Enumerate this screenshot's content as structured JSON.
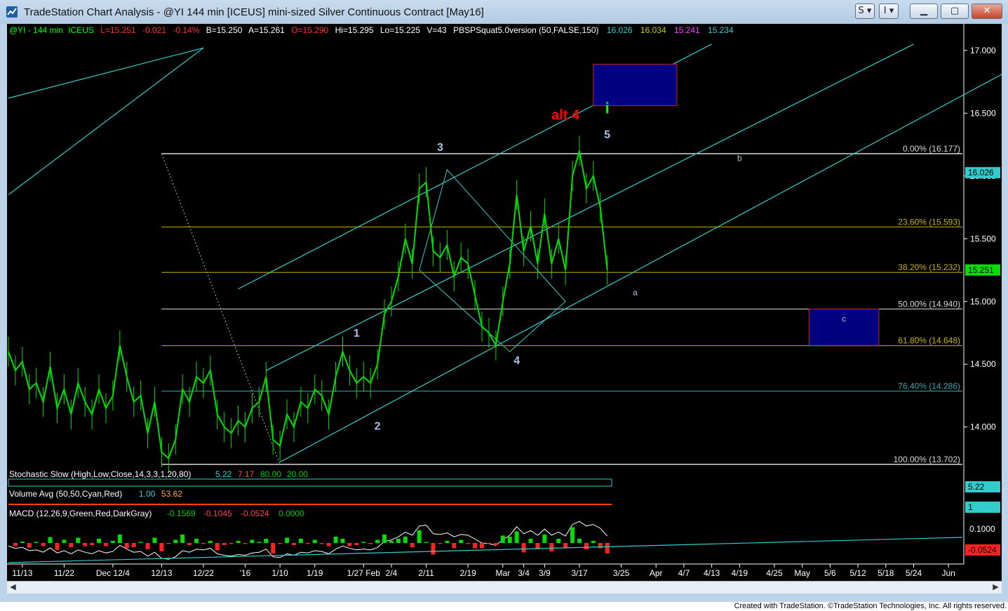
{
  "window": {
    "title": "TradeStation Chart Analysis - @YI 144 min [ICEUS] mini-sized Silver Continuous Contract [May16]",
    "buttons": [
      "S",
      "I"
    ],
    "credit": "Created with TradeStation. ©TradeStation Technologies, Inc. All rights reserved."
  },
  "colors": {
    "price": "#00dd00",
    "channel": "#33cccc",
    "fib_white": "#d8d8d8",
    "fib_yellow": "#c8b400",
    "fib_cyan": "#2fa7a7",
    "box_fill": "#000080",
    "box_stroke": "#cc2222",
    "wave_label": "#a8c0e8",
    "alt_label": "#ff0000",
    "i_label": "#00ff00"
  },
  "header": {
    "symbol": "@YI - 144 min",
    "exchange": "ICEUS",
    "last": "L=15.251",
    "change": "-0.021",
    "pct": "-0.14%",
    "bid": "B=15.250",
    "ask": "A=15.261",
    "open": "O=15.290",
    "high": "Hi=15.295",
    "low": "Lo=15.225",
    "volume": "V=43",
    "indicator": "PBSPSquat5.0version (50,FALSE,150)",
    "ind_values": [
      "16.026",
      "16.034",
      "15.241",
      "15.234"
    ]
  },
  "chart_data": {
    "type": "line",
    "ylim": [
      13.702,
      17.1
    ],
    "yticks": [
      "17.000",
      "16.500",
      "16.000",
      "15.500",
      "15.000",
      "14.500",
      "14.000"
    ],
    "ytick_values": [
      17.0,
      16.5,
      16.0,
      15.5,
      15.0,
      14.5,
      14.0
    ],
    "price_tags": [
      {
        "label": "16.026",
        "value": 16.026
      },
      {
        "label": "15.251",
        "value": 15.251
      }
    ],
    "xticks": [
      "11/13",
      "11/22",
      "Dec 12/4",
      "12/13",
      "12/22",
      "'16",
      "1/10",
      "1/19",
      "1/27 Feb",
      "2/4",
      "2/11",
      "2/19",
      "Mar",
      "3/4",
      "3/9",
      "3/17",
      "3/25",
      "Apr",
      "4/7",
      "4/13",
      "4/19",
      "4/25",
      "May",
      "5/6",
      "5/12",
      "5/18",
      "5/24",
      "Jun"
    ],
    "xtick_index": [
      2,
      8,
      15,
      22,
      28,
      34,
      39,
      44,
      51,
      55,
      60,
      66,
      71,
      74,
      77,
      82,
      88,
      93,
      97,
      101,
      105,
      110,
      114,
      118,
      122,
      126,
      130,
      135
    ],
    "x_count": 138,
    "price_series": {
      "x": [
        0,
        1,
        2,
        3,
        4,
        5,
        6,
        7,
        8,
        9,
        10,
        11,
        12,
        13,
        14,
        15,
        16,
        17,
        18,
        19,
        20,
        21,
        22,
        23,
        24,
        25,
        26,
        27,
        28,
        29,
        30,
        31,
        32,
        33,
        34,
        35,
        36,
        37,
        38,
        39,
        40,
        41,
        42,
        43,
        44,
        45,
        46,
        47,
        48,
        49,
        50,
        51,
        52,
        53,
        54,
        55,
        56,
        57,
        58,
        59,
        60,
        61,
        62,
        63,
        64,
        65,
        66,
        67,
        68,
        69,
        70,
        71,
        72,
        73,
        74,
        75,
        76,
        77,
        78,
        79,
        80,
        81,
        82,
        83,
        84,
        85,
        86
      ],
      "y": [
        14.6,
        14.45,
        14.52,
        14.3,
        14.35,
        14.2,
        14.48,
        14.15,
        14.3,
        14.1,
        14.35,
        14.2,
        14.1,
        14.3,
        14.15,
        14.25,
        14.65,
        14.4,
        14.2,
        14.25,
        13.95,
        14.2,
        13.8,
        13.75,
        13.9,
        14.3,
        14.2,
        14.4,
        14.35,
        14.45,
        14.1,
        14.0,
        13.95,
        14.05,
        14.0,
        14.15,
        14.2,
        14.4,
        13.9,
        13.85,
        14.1,
        14.0,
        14.2,
        14.15,
        14.3,
        14.25,
        14.1,
        14.4,
        14.6,
        14.45,
        14.35,
        14.4,
        14.35,
        14.5,
        14.9,
        15.0,
        15.2,
        15.5,
        15.3,
        15.9,
        15.95,
        15.4,
        15.35,
        15.45,
        15.2,
        15.35,
        15.3,
        15.05,
        14.8,
        14.75,
        14.65,
        15.0,
        15.3,
        15.85,
        15.4,
        15.6,
        15.3,
        15.7,
        15.3,
        15.5,
        15.25,
        16.0,
        16.2,
        15.9,
        16.0,
        15.75,
        15.25
      ]
    },
    "fib_levels": [
      {
        "label": "0.00% (16.177)",
        "value": 16.177
      },
      {
        "label": "23.60% (15.593)",
        "value": 15.593
      },
      {
        "label": "38.20% (15.232)",
        "value": 15.232
      },
      {
        "label": "50.00% (14.940)",
        "value": 14.94
      },
      {
        "label": "61.80% (14.648)",
        "value": 14.648
      },
      {
        "label": "76.40% (14.286)",
        "value": 14.286
      },
      {
        "label": "100.00% (13.702)",
        "value": 13.702
      }
    ],
    "fib_start_x": 22,
    "channels": [
      {
        "x1": 0,
        "y1": 16.62,
        "x2": 28,
        "y2": 17.02
      },
      {
        "x1": 0,
        "y1": 15.85,
        "x2": 28,
        "y2": 17.02
      },
      {
        "x1": 33,
        "y1": 15.1,
        "x2": 101,
        "y2": 17.05
      },
      {
        "x1": 37,
        "y1": 14.45,
        "x2": 130,
        "y2": 17.05
      },
      {
        "x1": 39,
        "y1": 13.72,
        "x2": 143,
        "y2": 16.82
      }
    ],
    "diamond": {
      "top": [
        63,
        16.05
      ],
      "left": [
        59,
        15.25
      ],
      "bottom": [
        72,
        14.6
      ],
      "right": [
        80,
        15.0
      ]
    },
    "boxes": [
      {
        "x1": 84,
        "x2": 96,
        "y1": 16.56,
        "y2": 16.89,
        "label": ""
      },
      {
        "x1": 115,
        "x2": 125,
        "y1": 14.65,
        "y2": 14.94,
        "label": "c"
      }
    ],
    "wave_labels": [
      {
        "text": "1",
        "x": 50,
        "y": 14.72
      },
      {
        "text": "2",
        "x": 53,
        "y": 13.98
      },
      {
        "text": "3",
        "x": 62,
        "y": 16.2
      },
      {
        "text": "4",
        "x": 73,
        "y": 14.5
      },
      {
        "text": "5",
        "x": 86,
        "y": 16.3
      },
      {
        "text": "a",
        "x": 90,
        "y": 15.05
      },
      {
        "text": "b",
        "x": 105,
        "y": 16.12
      }
    ],
    "alt_label": {
      "text": "alt  4",
      "x": 80,
      "y": 16.45
    },
    "i_label": {
      "text": "i",
      "x": 86,
      "y": 16.5
    }
  },
  "indicators": {
    "stochastic": {
      "label": "Stochastic Slow (High,Low,Close,14,3,3,1,20,80)",
      "v1": "5.22",
      "v2": "7.17",
      "v3": "80.00",
      "v4": "20.00",
      "tag": "5.22"
    },
    "volume": {
      "label": "Volume Avg (50,50,Cyan,Red)",
      "v1": "1.00",
      "v2": "53.62",
      "tag": "1"
    },
    "macd": {
      "label": "MACD (12,26,9,Green,Red,DarkGray)",
      "v1": "-0.1569",
      "v2": "-0.1045",
      "v3": "-0.0524",
      "v4": "0.0000",
      "tag1": "0.1000",
      "tag2": "-0.0524"
    }
  }
}
